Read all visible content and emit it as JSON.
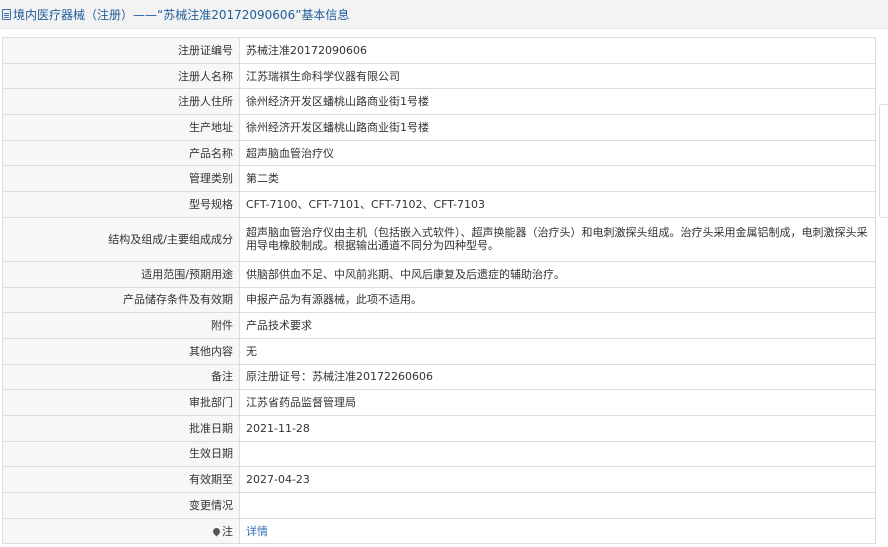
{
  "header": {
    "title": "境内医疗器械（注册）——“苏械注准20172090606”基本信息"
  },
  "rows": [
    {
      "label": "注册证编号",
      "value": "苏械注准20172090606"
    },
    {
      "label": "注册人名称",
      "value": "江苏瑞祺生命科学仪器有限公司"
    },
    {
      "label": "注册人住所",
      "value": "徐州经济开发区蟠桃山路商业街1号楼"
    },
    {
      "label": "生产地址",
      "value": "徐州经济开发区蟠桃山路商业街1号楼"
    },
    {
      "label": "产品名称",
      "value": "超声脑血管治疗仪"
    },
    {
      "label": "管理类别",
      "value": "第二类"
    },
    {
      "label": "型号规格",
      "value": "CFT-7100、CFT-7101、CFT-7102、CFT-7103"
    },
    {
      "label": "结构及组成/主要组成成分",
      "value": "超声脑血管治疗仪由主机（包括嵌入式软件）、超声换能器（治疗头）和电刺激探头组成。治疗头采用金属铝制成，电刺激探头采用导电橡胶制成。根据输出通道不同分为四种型号。"
    },
    {
      "label": "适用范围/预期用途",
      "value": "供脑部供血不足、中风前兆期、中风后康复及后遗症的辅助治疗。"
    },
    {
      "label": "产品储存条件及有效期",
      "value": "申报产品为有源器械，此项不适用。"
    },
    {
      "label": "附件",
      "value": "产品技术要求"
    },
    {
      "label": "其他内容",
      "value": "无"
    },
    {
      "label": "备注",
      "value": "原注册证号：苏械注准20172260606"
    },
    {
      "label": "审批部门",
      "value": "江苏省药品监督管理局"
    },
    {
      "label": "批准日期",
      "value": "2021-11-28"
    },
    {
      "label": "生效日期",
      "value": ""
    },
    {
      "label": "有效期至",
      "value": "2027-04-23"
    },
    {
      "label": "变更情况",
      "value": ""
    }
  ],
  "note": {
    "label": "注",
    "link": "详情",
    "icon": "pin-icon"
  }
}
